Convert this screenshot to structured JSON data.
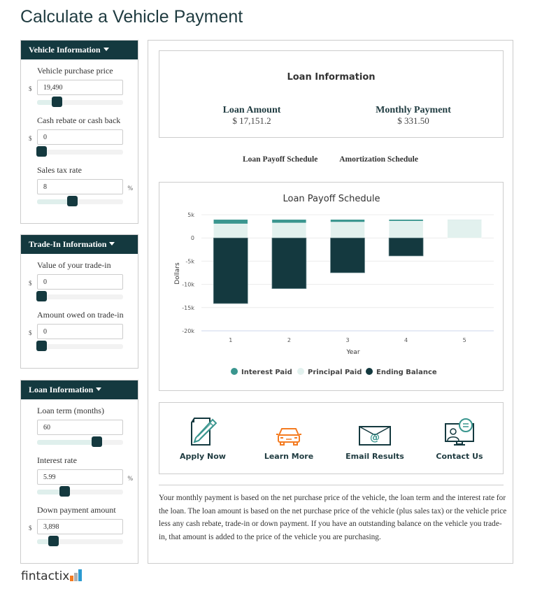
{
  "page": {
    "title": "Calculate a Vehicle Payment"
  },
  "panels": {
    "vehicle": {
      "title": "Vehicle Information",
      "fields": [
        {
          "label": "Vehicle purchase price",
          "prefix": "$",
          "suffix": "",
          "value": "19,490",
          "slider_fraction": 0.19
        },
        {
          "label": "Cash rebate or cash back",
          "prefix": "$",
          "suffix": "",
          "value": "0",
          "slider_fraction": 0.0
        },
        {
          "label": "Sales tax rate",
          "prefix": "",
          "suffix": "%",
          "value": "8",
          "slider_fraction": 0.4
        }
      ]
    },
    "tradein": {
      "title": "Trade-In Information",
      "fields": [
        {
          "label": "Value of your trade-in",
          "prefix": "$",
          "suffix": "",
          "value": "0",
          "slider_fraction": 0.0
        },
        {
          "label": "Amount owed on trade-in",
          "prefix": "$",
          "suffix": "",
          "value": "0",
          "slider_fraction": 0.0
        }
      ]
    },
    "loan": {
      "title": "Loan Information",
      "fields": [
        {
          "label": "Loan term (months)",
          "prefix": "",
          "suffix": "",
          "value": "60",
          "slider_fraction": 0.72
        },
        {
          "label": "Interest rate",
          "prefix": "",
          "suffix": "%",
          "value": "5.99",
          "slider_fraction": 0.3
        },
        {
          "label": "Down payment amount",
          "prefix": "$",
          "suffix": "",
          "value": "3,898",
          "slider_fraction": 0.15
        }
      ]
    }
  },
  "summary": {
    "title": "Loan Information",
    "loan_amount_label": "Loan Amount",
    "loan_amount_value": "$ 17,151.2",
    "monthly_payment_label": "Monthly Payment",
    "monthly_payment_value": "$ 331.50"
  },
  "tabs": [
    "Loan Payoff Schedule",
    "Amortization Schedule"
  ],
  "chart_data": {
    "type": "bar",
    "stacked": true,
    "title": "Loan Payoff Schedule",
    "xlabel": "Year",
    "ylabel": "Dollars",
    "categories": [
      "1",
      "2",
      "3",
      "4",
      "5"
    ],
    "ylim": [
      -20000,
      5000
    ],
    "yticks": [
      5000,
      0,
      -5000,
      -10000,
      -15000,
      -20000
    ],
    "ytick_labels": [
      "5k",
      "0",
      "-5k",
      "-10k",
      "-15k",
      "-20k"
    ],
    "grid": true,
    "legend_position": "bottom",
    "series": [
      {
        "name": "Interest Paid",
        "color": "#3a968f",
        "values": [
          950,
          764,
          567,
          358,
          100
        ]
      },
      {
        "name": "Principal Paid",
        "color": "#e2f1ee",
        "values": [
          3028,
          3214,
          3411,
          3620,
          3878
        ]
      },
      {
        "name": "Ending Balance",
        "color": "#14393f",
        "values": [
          -14123,
          -10909,
          -7498,
          -3878,
          0
        ]
      }
    ]
  },
  "actions": [
    {
      "label": "Apply Now",
      "icon": "document-pencil-icon"
    },
    {
      "label": "Learn More",
      "icon": "car-icon"
    },
    {
      "label": "Email Results",
      "icon": "email-icon"
    },
    {
      "label": "Contact Us",
      "icon": "contact-chat-icon"
    }
  ],
  "disclaimer": "Your monthly payment is based on the net purchase price of the vehicle, the loan term and the interest rate for the loan. The loan amount is based on the net purchase price of the vehicle (plus sales tax) or the vehicle price less any cash rebate, trade-in or down payment. If you have an outstanding balance on the vehicle you trade-in, that amount is added to the price of the vehicle you are purchasing.",
  "brand": {
    "name": "fintactix",
    "bar_colors": [
      "#f47b20",
      "#b0b0b0",
      "#2b9bd1"
    ]
  },
  "colors": {
    "dark": "#14393f",
    "teal": "#3a968f",
    "light": "#e2f1ee",
    "orange": "#f47b20"
  }
}
